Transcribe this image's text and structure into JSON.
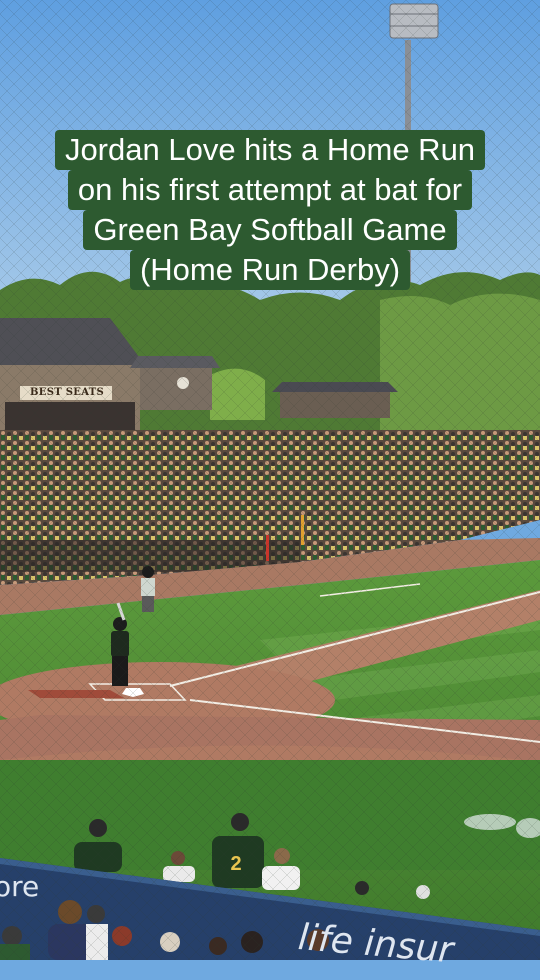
{
  "caption": {
    "lines": [
      "Jordan Love hits a Home Run",
      "on his first attempt at bat for",
      "Green Bay Softball Game",
      "(Home Run Derby)"
    ]
  },
  "scene": {
    "sign_text": "BEST SEATS",
    "jersey_number": "2",
    "banner_text_right": "life insur",
    "banner_text_left": "ore"
  },
  "colors": {
    "sky": "#6fa9e0",
    "caption_background": "#2d5a30",
    "caption_text": "#ffffff",
    "grass": "#4f8a36",
    "infield_dirt": "#b07a63"
  }
}
